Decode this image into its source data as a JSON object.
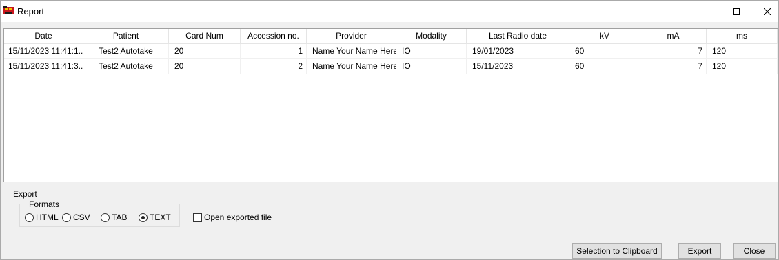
{
  "window": {
    "title": "Report",
    "minimize_icon": "minimize-icon",
    "maximize_icon": "maximize-icon",
    "close_icon": "close-icon"
  },
  "table": {
    "columns": [
      "Date",
      "Patient",
      "Card Num",
      "Accession no.",
      "Provider",
      "Modality",
      "Last Radio date",
      "kV",
      "mA",
      "ms"
    ],
    "rows": [
      [
        "15/11/2023 11:41:1...",
        "Test2 Autotake",
        "20",
        "1",
        "Name Your Name Here",
        "IO",
        "19/01/2023",
        "60",
        "7",
        "120"
      ],
      [
        "15/11/2023 11:41:3...",
        "Test2 Autotake",
        "20",
        "2",
        "Name Your Name Here",
        "IO",
        "15/11/2023",
        "60",
        "7",
        "120"
      ]
    ]
  },
  "export": {
    "group_label": "Export",
    "formats_label": "Formats",
    "formats": [
      {
        "label": "HTML",
        "checked": false
      },
      {
        "label": "CSV",
        "checked": false
      },
      {
        "label": "TAB",
        "checked": false
      },
      {
        "label": "TEXT",
        "checked": true
      }
    ],
    "open_file_label": "Open exported file",
    "open_file_checked": false
  },
  "buttons": {
    "clipboard": "Selection to Clipboard",
    "export": "Export",
    "close": "Close"
  }
}
